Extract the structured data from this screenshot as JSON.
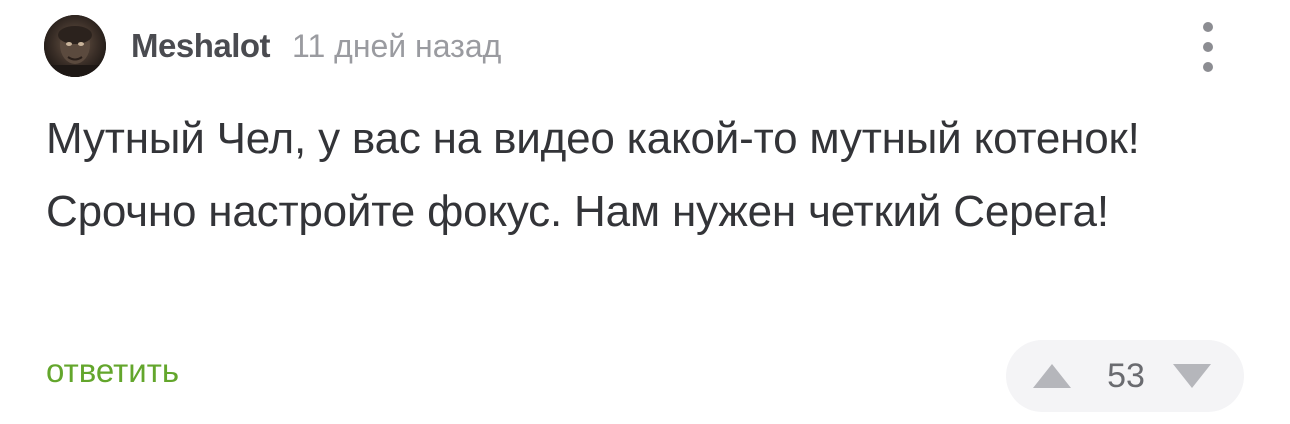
{
  "comment": {
    "author": "Meshalot",
    "time": "11 дней назад",
    "text": "Мутный Чел, у вас на видео какой-то мутный котенок! Срочно настройте фокус. Нам нужен четкий Серега!",
    "reply_label": "ответить",
    "rating": "53"
  },
  "icons": {
    "menu": "more-vertical-icon",
    "upvote": "triangle-up-icon",
    "downvote": "triangle-down-icon"
  },
  "colors": {
    "reply": "#63a62c",
    "author": "#4a4b50",
    "time": "#9a9ba0",
    "text": "#333438",
    "vote_bg": "#f4f4f6",
    "vote_icon": "#b5b6bb"
  }
}
